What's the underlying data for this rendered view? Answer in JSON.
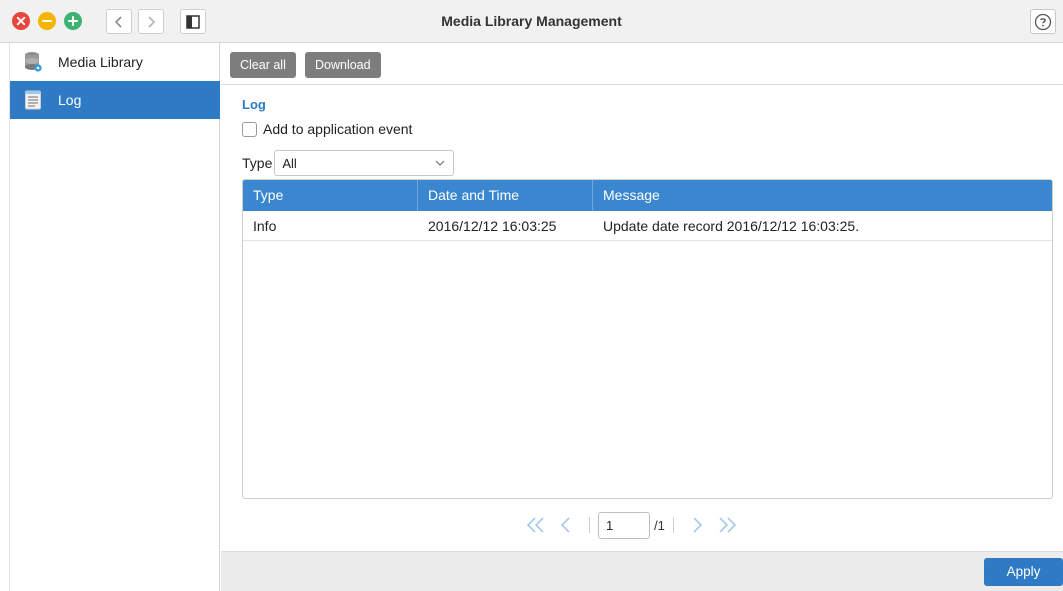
{
  "window": {
    "title": "Media Library Management"
  },
  "sidebar": {
    "items": [
      {
        "label": "Media Library",
        "icon": "database-icon",
        "active": false
      },
      {
        "label": "Log",
        "icon": "log-list-icon",
        "active": true
      }
    ]
  },
  "toolbar": {
    "clear_all_label": "Clear all",
    "download_label": "Download"
  },
  "log": {
    "section_title": "Log",
    "add_event_label": "Add to application event",
    "add_event_checked": false,
    "type_label": "Type",
    "type_value": "All"
  },
  "table": {
    "columns": [
      "Type",
      "Date and Time",
      "Message"
    ],
    "rows": [
      {
        "type": "Info",
        "datetime": "2016/12/12 16:03:25",
        "message": "Update date record 2016/12/12 16:03:25."
      }
    ]
  },
  "pagination": {
    "current_page": "1",
    "total": "/1"
  },
  "footer": {
    "apply_label": "Apply"
  },
  "colors": {
    "accent": "#2e7ac4",
    "header": "#3a86cf",
    "close": "#e8453c",
    "minimize": "#f4b400",
    "maximize": "#3cb371"
  }
}
